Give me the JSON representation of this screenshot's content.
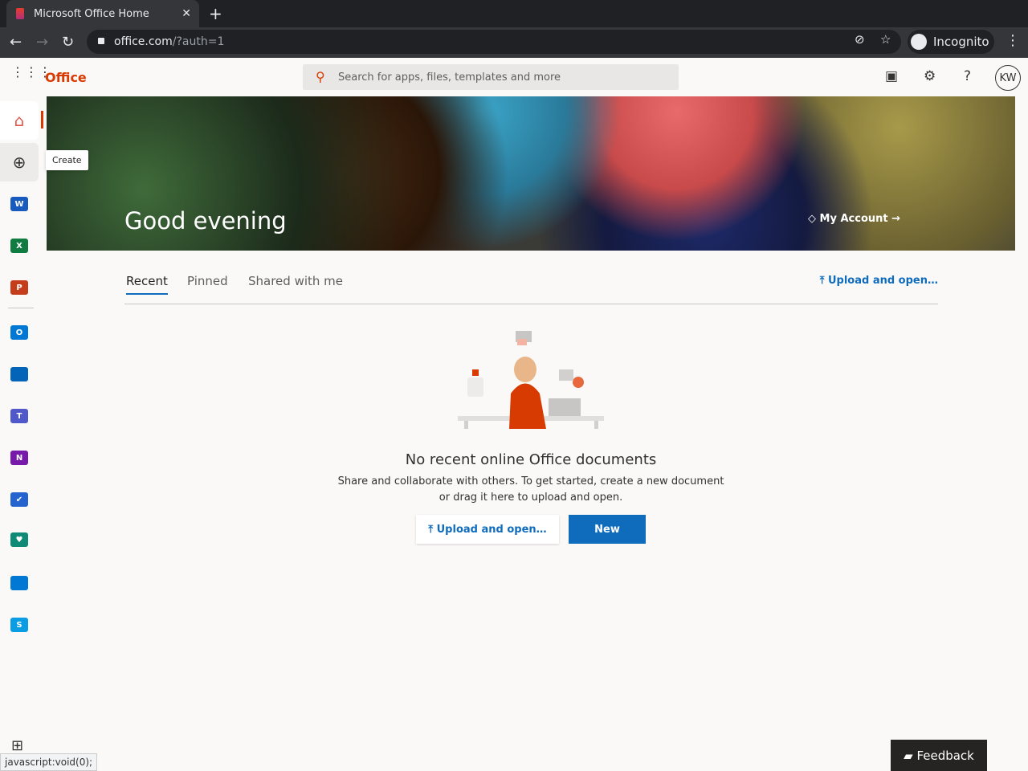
{
  "browser": {
    "tab_title": "Microsoft Office Home",
    "url_host": "office.com",
    "url_path": "/?auth=1",
    "profile": "Incognito"
  },
  "header": {
    "brand": "Office",
    "search_placeholder": "Search for apps, files, templates and more",
    "avatar": "KW"
  },
  "rail": {
    "tooltip": "Create",
    "apps": [
      {
        "name": "Word",
        "letter": "W",
        "color": "#185abd"
      },
      {
        "name": "Excel",
        "letter": "X",
        "color": "#107c41"
      },
      {
        "name": "PowerPoint",
        "letter": "P",
        "color": "#c43e1c"
      },
      {
        "name": "Outlook",
        "letter": "O",
        "color": "#0078d4"
      },
      {
        "name": "OneDrive",
        "letter": "",
        "color": "#0364b8"
      },
      {
        "name": "Teams",
        "letter": "T",
        "color": "#5059c9"
      },
      {
        "name": "OneNote",
        "letter": "N",
        "color": "#7719aa"
      },
      {
        "name": "To Do",
        "letter": "✔",
        "color": "#2564cf"
      },
      {
        "name": "Family Safety",
        "letter": "♥",
        "color": "#0e8a76"
      },
      {
        "name": "Calendar",
        "letter": "",
        "color": "#0078d4"
      },
      {
        "name": "Skype",
        "letter": "S",
        "color": "#0a9de4"
      }
    ]
  },
  "hero": {
    "greeting": "Good evening",
    "account_link": "My Account"
  },
  "tabs": {
    "items": [
      "Recent",
      "Pinned",
      "Shared with me"
    ],
    "upload": "Upload and open…"
  },
  "empty": {
    "title": "No recent online Office documents",
    "desc": "Share and collaborate with others. To get started, create a new document or drag it here to upload and open.",
    "upload_button": "Upload and open…",
    "new_button": "New"
  },
  "status_bar": "javascript:void(0);",
  "feedback": "Feedback"
}
